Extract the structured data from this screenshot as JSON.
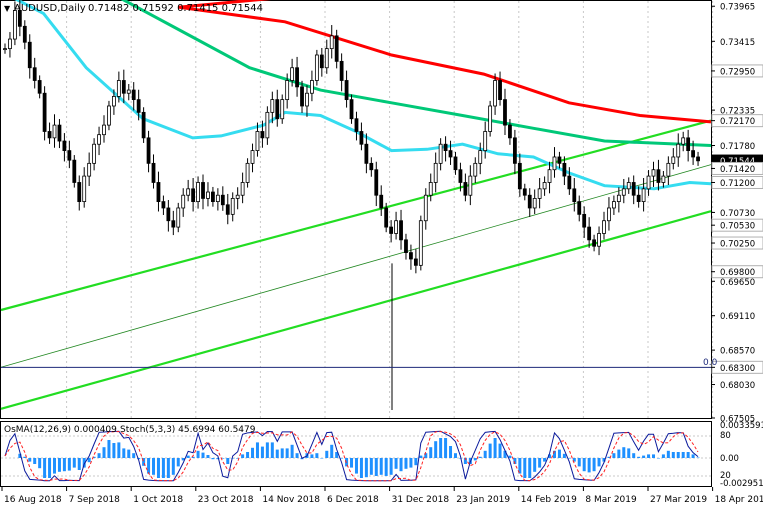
{
  "header": {
    "title": "AUDUSD,Daily",
    "ohlc": "0.71482 0.71592 0.71415 0.71544"
  },
  "indicator_header": "OsMA(12,26,9) 0.000409",
  "indicator_header2": "Stoch(5,3,3) 45.6994 60.5479",
  "fib_label": "0.0",
  "colors": {
    "background": "#ffffff",
    "candle": "#000000",
    "ema200": "#ff0000",
    "ema144": "#00c878",
    "ema50": "#35dcf0",
    "channel": "#22dd22",
    "level_line": "#1e2a7a",
    "price_highlight": "#000000",
    "osma_bars": "#1e90ff",
    "stoch_main": "#0b1a9c",
    "stoch_signal": "#ff2020"
  },
  "chart_data": {
    "type": "candlestick",
    "symbol": "AUDUSD",
    "timeframe": "Daily",
    "ylim": [
      0.67505,
      0.74
    ],
    "price_axis_ticks": [
      "0.73965",
      "0.73415",
      "0.72950",
      "0.72335",
      "0.72170",
      "0.71780",
      "0.71544",
      "0.71420",
      "0.71200",
      "0.70730",
      "0.70530",
      "0.70250",
      "0.69800",
      "0.69650",
      "0.69110",
      "0.68570",
      "0.68300",
      "0.68030",
      "0.67505"
    ],
    "highlighted_levels": [
      "0.72950",
      "0.72170",
      "0.71544",
      "0.71420",
      "0.71200",
      "0.70530",
      "0.70250",
      "0.69800",
      "0.68300"
    ],
    "current_price": "0.71544",
    "x_tick_labels": [
      "16 Aug 2018",
      "7 Sep 2018",
      "1 Oct 2018",
      "23 Oct 2018",
      "14 Nov 2018",
      "6 Dec 2018",
      "31 Dec 2018",
      "23 Jan 2019",
      "14 Feb 2019",
      "8 Mar 2019",
      "27 Mar 2019",
      "18 Apr 2019"
    ],
    "series": [
      {
        "kind": "ma",
        "period": 200,
        "points": [
          [
            0.7745,
            0.745
          ],
          [
            0.25,
            0.7395
          ],
          [
            0.4,
            0.7372
          ],
          [
            0.55,
            0.732
          ],
          [
            0.68,
            0.729
          ],
          [
            0.8,
            0.7245
          ],
          [
            0.9,
            0.7225
          ],
          [
            1.0,
            0.7215
          ]
        ]
      },
      {
        "kind": "ma",
        "period": 144,
        "points": [
          [
            0.0,
            0.745
          ],
          [
            0.15,
            0.742
          ],
          [
            0.25,
            0.736
          ],
          [
            0.35,
            0.73
          ],
          [
            0.45,
            0.7265
          ],
          [
            0.55,
            0.7245
          ],
          [
            0.65,
            0.7225
          ],
          [
            0.75,
            0.7205
          ],
          [
            0.85,
            0.7185
          ],
          [
            1.0,
            0.7178
          ]
        ]
      },
      {
        "kind": "ma",
        "period": 50,
        "points": [
          [
            0.0,
            0.742
          ],
          [
            0.06,
            0.7385
          ],
          [
            0.12,
            0.73
          ],
          [
            0.2,
            0.722
          ],
          [
            0.27,
            0.719
          ],
          [
            0.31,
            0.7193
          ],
          [
            0.37,
            0.721
          ],
          [
            0.4,
            0.723
          ],
          [
            0.45,
            0.7225
          ],
          [
            0.5,
            0.72
          ],
          [
            0.55,
            0.717
          ],
          [
            0.6,
            0.7172
          ],
          [
            0.65,
            0.718
          ],
          [
            0.7,
            0.7165
          ],
          [
            0.75,
            0.716
          ],
          [
            0.8,
            0.7135
          ],
          [
            0.85,
            0.7115
          ],
          [
            0.92,
            0.711
          ],
          [
            0.97,
            0.712
          ],
          [
            1.0,
            0.7118
          ]
        ]
      },
      {
        "kind": "channel",
        "points": [
          [
            0.0,
            0.692
          ],
          [
            1.0,
            0.7217
          ]
        ]
      },
      {
        "kind": "channel",
        "points": [
          [
            0.0,
            0.6765
          ],
          [
            1.0,
            0.7075
          ]
        ]
      },
      {
        "kind": "channel_mid",
        "points": [
          [
            0.0,
            0.683
          ],
          [
            1.0,
            0.7148
          ]
        ]
      }
    ],
    "candles_close": [
      0.733,
      0.7345,
      0.739,
      0.7365,
      0.734,
      0.73,
      0.728,
      0.726,
      0.72,
      0.719,
      0.721,
      0.7185,
      0.717,
      0.7155,
      0.712,
      0.709,
      0.713,
      0.715,
      0.718,
      0.7195,
      0.721,
      0.724,
      0.7255,
      0.728,
      0.726,
      0.7265,
      0.725,
      0.723,
      0.719,
      0.715,
      0.712,
      0.709,
      0.708,
      0.706,
      0.705,
      0.708,
      0.71,
      0.711,
      0.709,
      0.712,
      0.7095,
      0.7105,
      0.709,
      0.71,
      0.7085,
      0.707,
      0.7095,
      0.71,
      0.712,
      0.715,
      0.717,
      0.72,
      0.719,
      0.723,
      0.725,
      0.722,
      0.725,
      0.728,
      0.73,
      0.727,
      0.724,
      0.726,
      0.728,
      0.732,
      0.73,
      0.733,
      0.735,
      0.731,
      0.728,
      0.725,
      0.722,
      0.72,
      0.718,
      0.715,
      0.714,
      0.71,
      0.708,
      0.705,
      0.704,
      0.706,
      0.703,
      0.701,
      0.7,
      0.699,
      0.706,
      0.71,
      0.712,
      0.715,
      0.718,
      0.717,
      0.716,
      0.714,
      0.712,
      0.71,
      0.713,
      0.715,
      0.717,
      0.72,
      0.724,
      0.728,
      0.725,
      0.721,
      0.719,
      0.715,
      0.711,
      0.71,
      0.708,
      0.7095,
      0.711,
      0.712,
      0.714,
      0.716,
      0.715,
      0.713,
      0.711,
      0.709,
      0.707,
      0.705,
      0.703,
      0.702,
      0.704,
      0.706,
      0.708,
      0.709,
      0.71,
      0.711,
      0.712,
      0.71,
      0.709,
      0.711,
      0.713,
      0.714,
      0.712,
      0.713,
      0.715,
      0.716,
      0.718,
      0.719,
      0.717,
      0.716,
      0.7154
    ]
  }
}
